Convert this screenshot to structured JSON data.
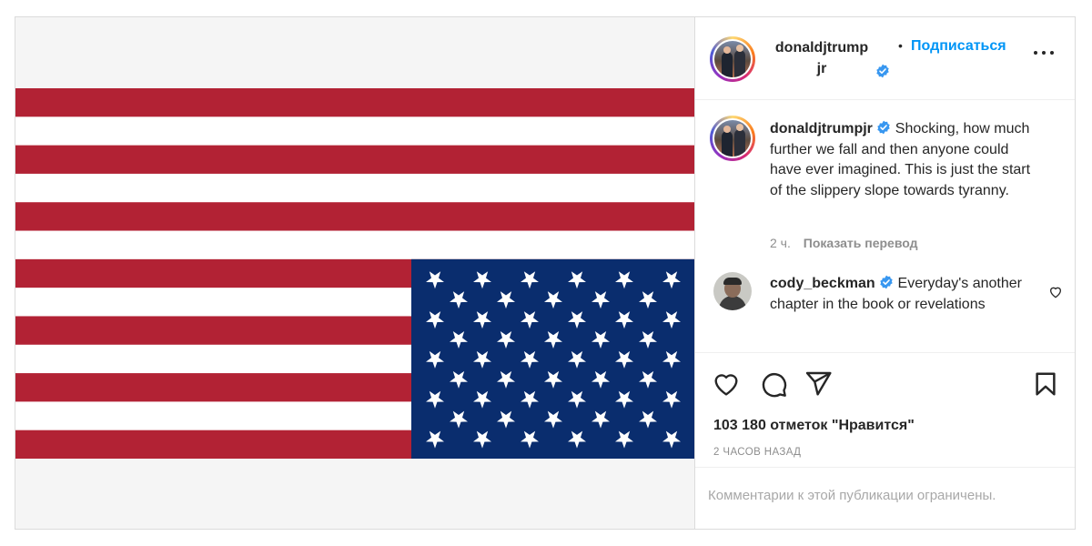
{
  "header": {
    "username_line1": "donaldjtrump",
    "username_line2": "jr",
    "separator": "•",
    "follow_label": "Подписаться"
  },
  "caption": {
    "username": "donaldjtrumpjr",
    "text": "Shocking, how much further we fall and then anyone could have ever imagined. This is just the start of the slippery slope towards tyranny.",
    "time": "2 ч.",
    "translate_label": "Показать перевод"
  },
  "comment": {
    "username": "cody_beckman",
    "text": "Everyday's another chapter in the book or revelations"
  },
  "stats": {
    "likes": "103 180 отметок \"Нравится\"",
    "time_ago": "2 ЧАСОВ НАЗАД"
  },
  "footer": {
    "restricted_text": "Комментарии к этой публикации ограничены."
  },
  "image": {
    "description_icon": "upside-down-us-flag",
    "stripe_red": "#b22234",
    "canton_blue": "#0a2d6e",
    "stripe_count": 13,
    "star_count": 50
  },
  "colors": {
    "link": "#0095f6",
    "verified": "#3897f0",
    "text": "#262626",
    "muted": "#8e8e8e"
  },
  "icons": [
    "verified-badge-icon",
    "more-options-icon",
    "heart-icon",
    "comment-icon",
    "share-icon",
    "bookmark-icon",
    "heart-small-icon"
  ]
}
